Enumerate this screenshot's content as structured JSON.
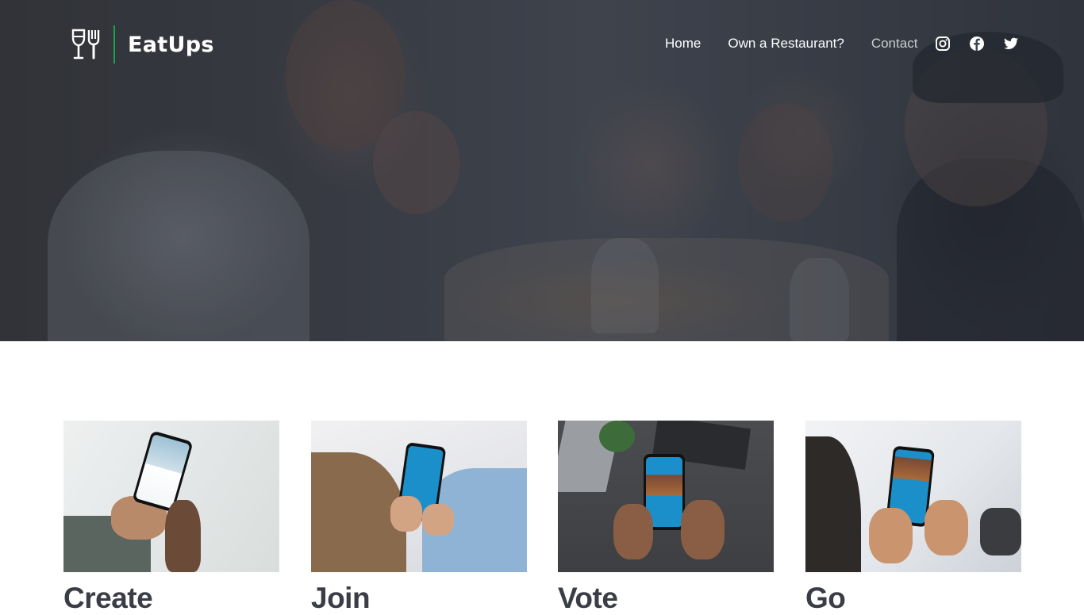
{
  "brand": {
    "name": "EatUps",
    "accent": "#16a34a"
  },
  "nav": [
    {
      "label": "Home",
      "icon": null
    },
    {
      "label": "Own a Restaurant?",
      "icon": null
    },
    {
      "label": "Contact",
      "icon": null
    }
  ],
  "social": [
    {
      "name": "instagram-icon"
    },
    {
      "name": "facebook-icon"
    },
    {
      "name": "twitter-icon"
    }
  ],
  "steps": [
    {
      "title": "Create"
    },
    {
      "title": "Join"
    },
    {
      "title": "Vote"
    },
    {
      "title": "Go"
    }
  ],
  "colors": {
    "app_screen": "#1a8fc9",
    "heading": "#3a3d45"
  }
}
